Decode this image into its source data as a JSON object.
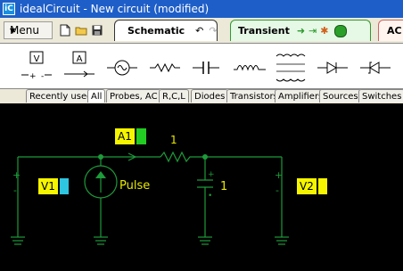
{
  "window": {
    "title": "idealCircuit - New circuit (modified)",
    "icon_text": "iC"
  },
  "toolbar": {
    "menu_label": "Menu",
    "tabs": [
      {
        "label": "Schematic"
      },
      {
        "label": "Transient"
      },
      {
        "label": "AC"
      }
    ]
  },
  "palette": {
    "voltage_source_label": "V",
    "current_source_label": "A"
  },
  "categories": [
    "Recently used",
    "All",
    "Probes, AC",
    "R,C,L",
    "Diodes",
    "Transistors",
    "Amplifiers",
    "Sources",
    "Switches"
  ],
  "schematic": {
    "ammeter_label": "A1",
    "resistor_value": "1",
    "source_value": "Pulse",
    "capacitor_value": "1",
    "voltmeter1_label": "V1",
    "voltmeter2_label": "V2",
    "colors": {
      "wire": "#1d9b3a",
      "label_text": "#e8e800",
      "v1_marker": "#2ec5e0",
      "a1_marker": "#22cc22",
      "v2_marker": "#f5f500"
    }
  }
}
